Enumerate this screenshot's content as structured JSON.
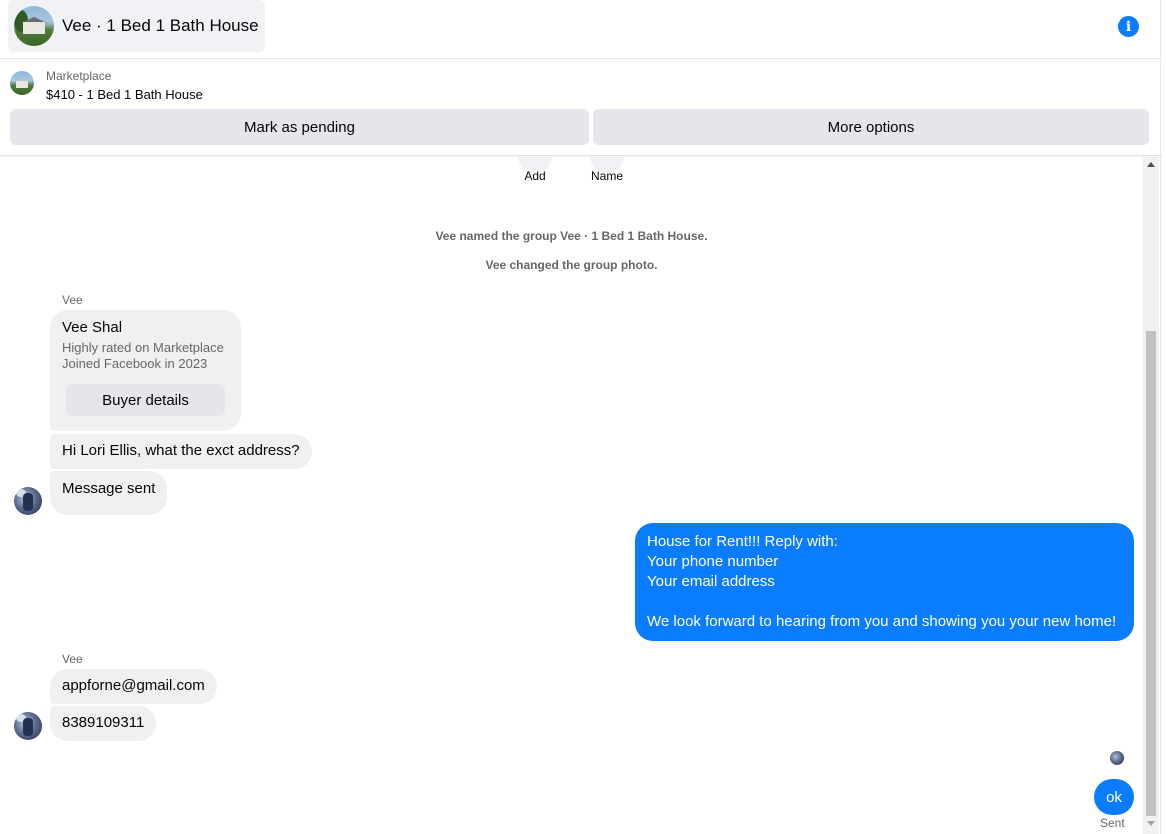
{
  "header": {
    "title": "Vee · 1 Bed 1 Bath House",
    "info_icon": "info-icon",
    "info_glyph": "i"
  },
  "listing": {
    "source": "Marketplace",
    "title": "$410 - 1 Bed 1 Bath House",
    "buttons": {
      "pending": "Mark as pending",
      "more": "More options"
    }
  },
  "group_actions": [
    {
      "label": "Add"
    },
    {
      "label": "Name"
    }
  ],
  "system_messages": [
    "Vee named the group Vee · 1 Bed 1 Bath House.",
    "Vee changed the group photo."
  ],
  "thread": {
    "sender_first": "Vee",
    "profile_card": {
      "name": "Vee Shal",
      "line1": "Highly rated on Marketplace",
      "line2": "Joined Facebook in 2023",
      "button": "Buyer details"
    },
    "incoming_1": "Hi Lori Ellis, what the exct address?",
    "incoming_2": "Message sent",
    "outgoing": {
      "lines": [
        "House for Rent!!! Reply with:",
        "Your phone number",
        "Your email address",
        "",
        "We look forward to hearing from you and showing you your new home!"
      ]
    },
    "sender_second": "Vee",
    "incoming_3": "appforne@gmail.com",
    "incoming_4": "8389109311",
    "reply": "ok",
    "status": "Sent"
  },
  "colors": {
    "accent": "#0a7cff",
    "bubble_gray": "#f0f0f0",
    "button_gray": "#e4e6eb",
    "secondary_text": "#65676b"
  }
}
